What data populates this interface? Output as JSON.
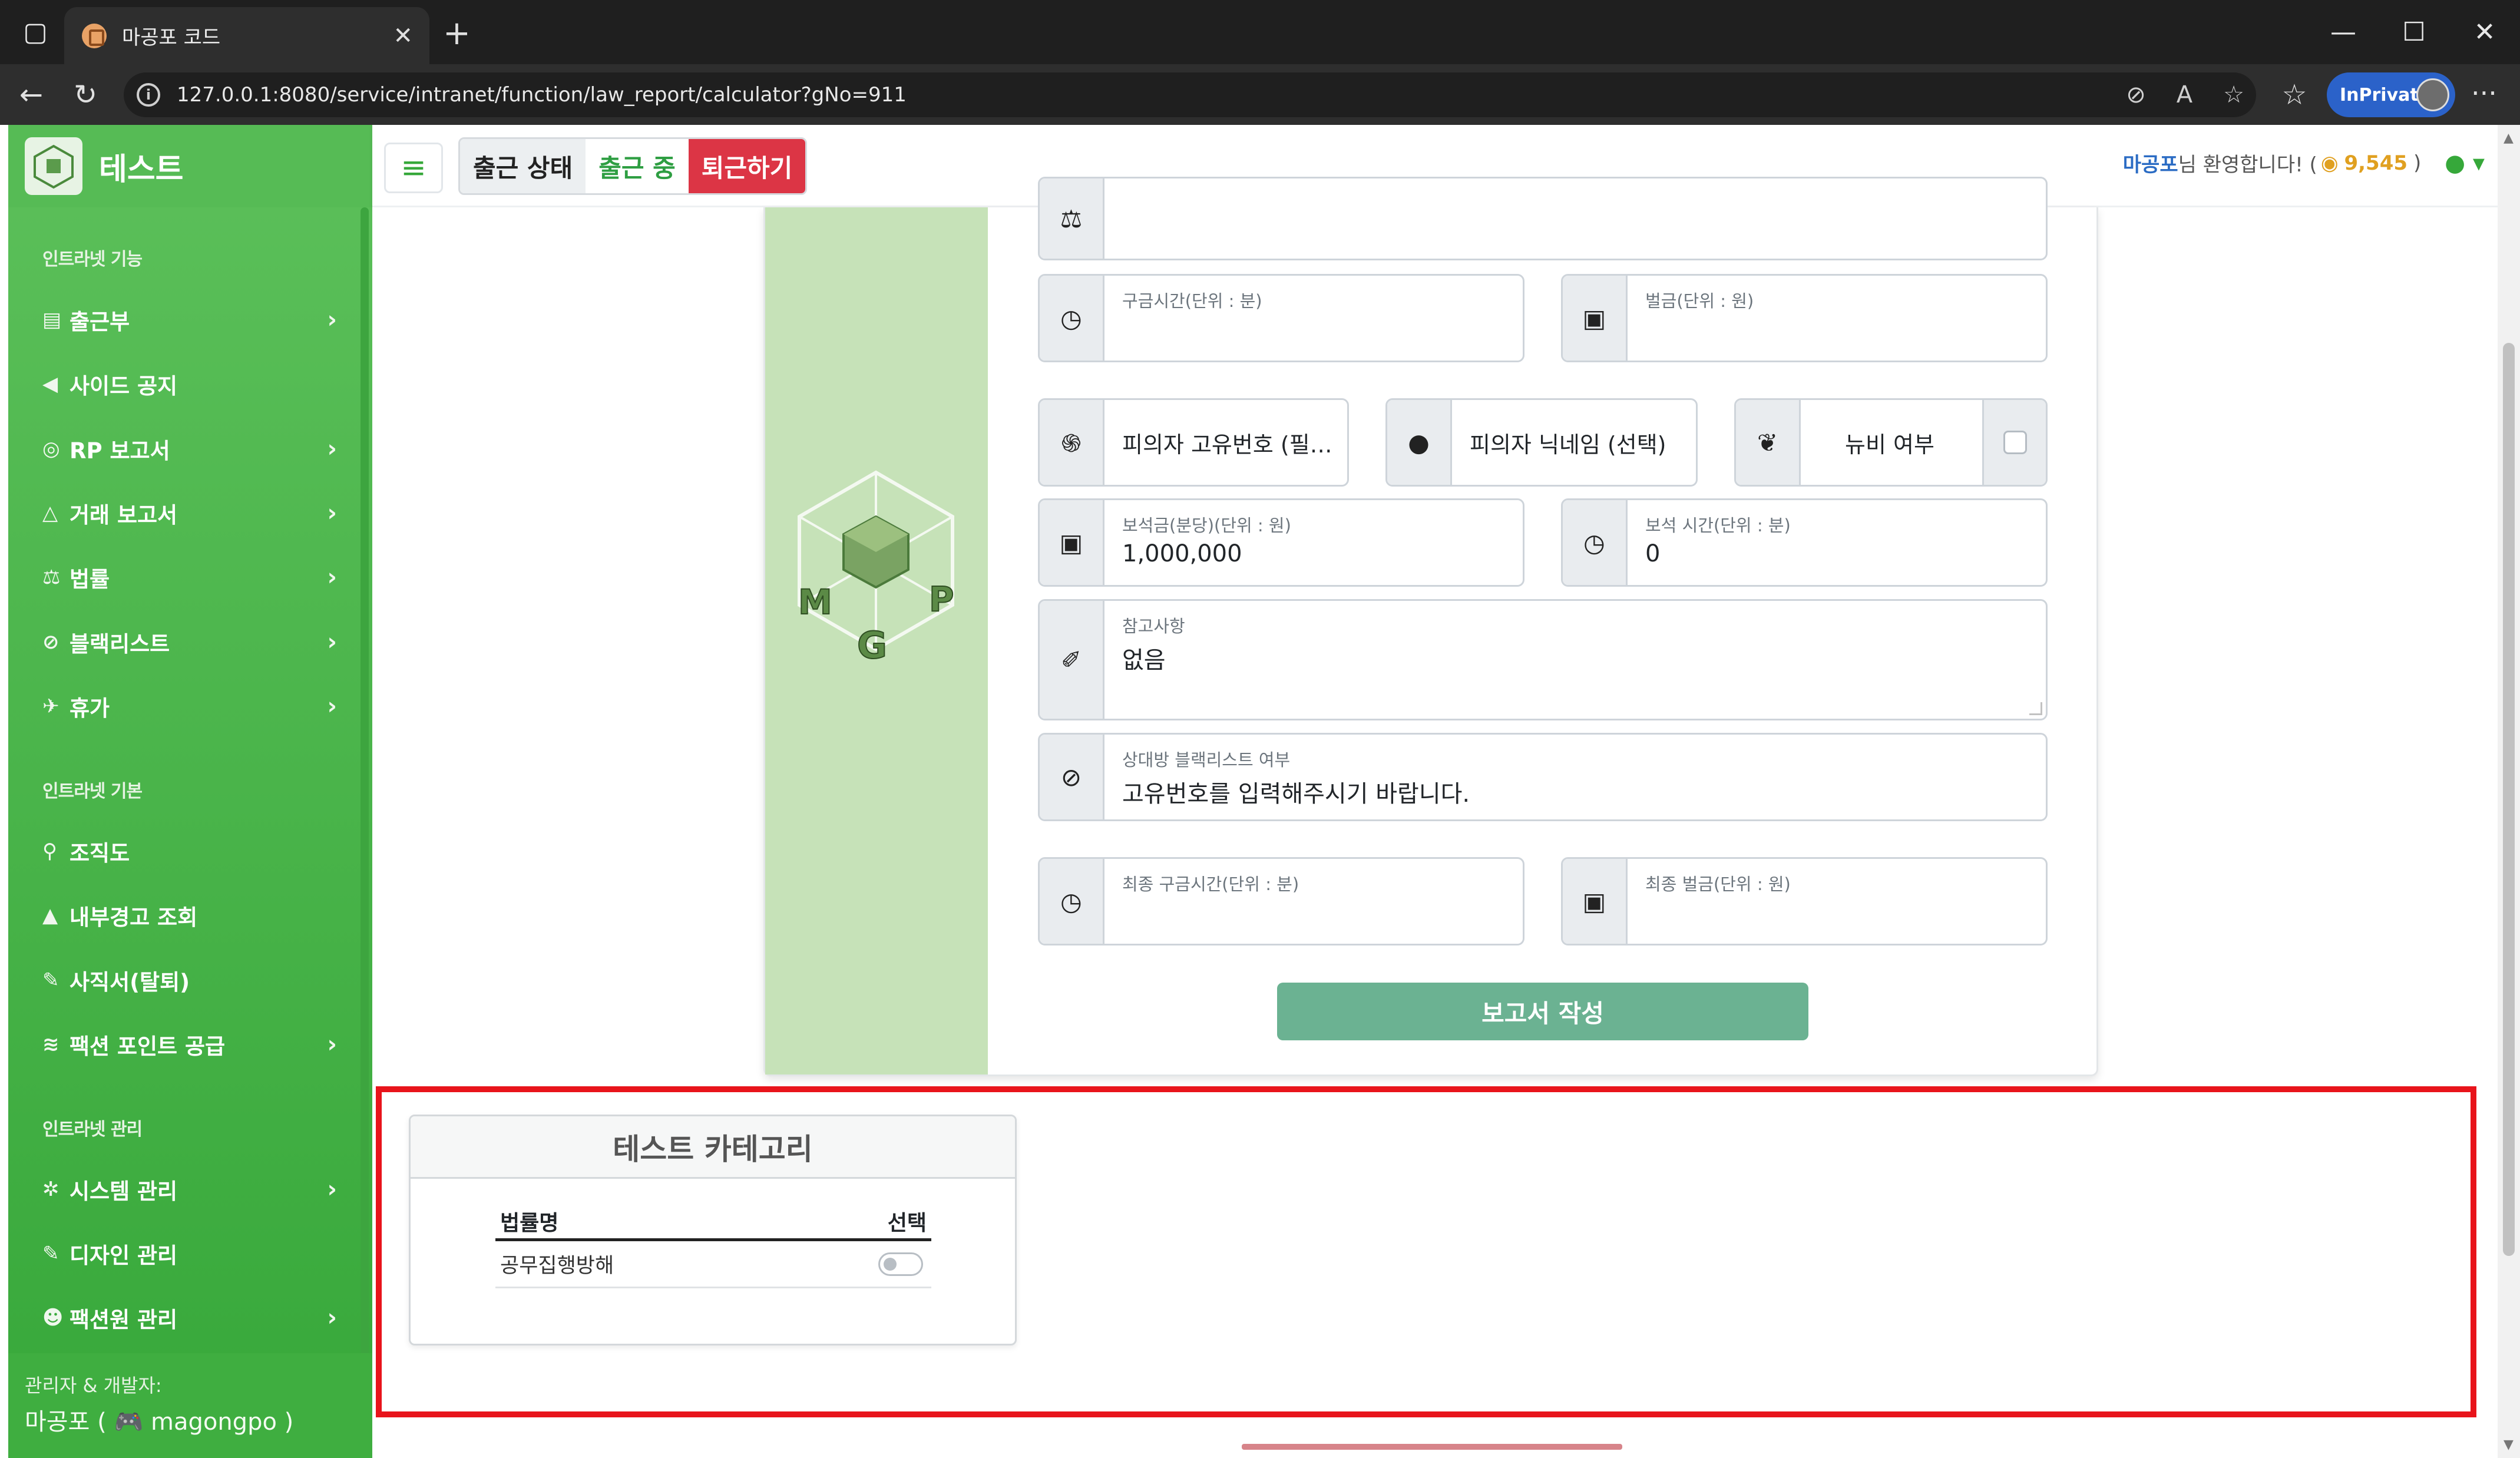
{
  "browser": {
    "tab_title": "마공포 코드",
    "url": "127.0.0.1:8080/service/intranet/function/law_report/calculator?gNo=911",
    "inprivate_label": "InPrivate"
  },
  "sidebar": {
    "brand": "테스트",
    "sections": [
      {
        "heading": "인트라넷 기능"
      },
      {
        "heading": "인트라넷 기본"
      },
      {
        "heading": "인트라넷 관리"
      }
    ],
    "items": [
      {
        "label": "출근부",
        "icon": "book-icon",
        "chevron": true
      },
      {
        "label": "사이드 공지",
        "icon": "megaphone-icon",
        "chevron": false
      },
      {
        "label": "RP 보고서",
        "icon": "gamepad-icon",
        "chevron": true
      },
      {
        "label": "거래 보고서",
        "icon": "flask-icon",
        "chevron": true
      },
      {
        "label": "법률",
        "icon": "scale-icon",
        "chevron": true
      },
      {
        "label": "블랙리스트",
        "icon": "ban-icon",
        "chevron": true
      },
      {
        "label": "휴가",
        "icon": "plane-icon",
        "chevron": true
      },
      {
        "label": "조직도",
        "icon": "sitemap-icon",
        "chevron": false
      },
      {
        "label": "내부경고 조회",
        "icon": "warning-icon",
        "chevron": false
      },
      {
        "label": "사직서(탈퇴)",
        "icon": "pen-icon",
        "chevron": false
      },
      {
        "label": "팩션 포인트 공급",
        "icon": "coins-icon",
        "chevron": true
      },
      {
        "label": "시스템 관리",
        "icon": "gear-icon",
        "chevron": true
      },
      {
        "label": "디자인 관리",
        "icon": "brush-icon",
        "chevron": false
      },
      {
        "label": "팩션원 관리",
        "icon": "users-gear-icon",
        "chevron": true
      }
    ],
    "footer": {
      "line1": "관리자 & 개발자:",
      "line2_prefix": "마공포 (",
      "line2_name": "magongpo",
      "line2_suffix": ")"
    }
  },
  "topnav": {
    "status_label": "출근 상태",
    "status_value": "출근 중",
    "leave_button": "퇴근하기",
    "welcome_name": "마공포",
    "welcome_text": "님 환영합니다! (",
    "points": "9,545",
    "welcome_close": ")"
  },
  "form": {
    "arrest_time": {
      "label": "구금시간(단위 : 분)",
      "value": ""
    },
    "fine": {
      "label": "벌금(단위 : 원)",
      "value": ""
    },
    "suspect_id": {
      "placeholder": "피의자 고유번호 (필…"
    },
    "suspect_nick": {
      "placeholder": "피의자 닉네임 (선택)"
    },
    "newbie": {
      "label": "뉴비 여부",
      "checked": false
    },
    "bail": {
      "label": "보석금(분당)(단위 : 원)",
      "value": "1,000,000"
    },
    "bail_time": {
      "label": "보석 시간(단위 : 분)",
      "value": "0"
    },
    "notes": {
      "label": "참고사항",
      "value": "없음"
    },
    "blacklist": {
      "label": "상대방 블랙리스트 여부",
      "value": "고유번호를 입력해주시기 바랍니다."
    },
    "final_time": {
      "label": "최종 구금시간(단위 : 분)",
      "value": ""
    },
    "final_fine": {
      "label": "최종 벌금(단위 : 원)",
      "value": ""
    },
    "submit_label": "보고서 작성"
  },
  "category": {
    "title": "테스트 카테고리",
    "headers": [
      "법률명",
      "선택"
    ],
    "rows": [
      {
        "name": "공무집행방해",
        "selected": false
      }
    ]
  },
  "colors": {
    "sidebar_green": "#37a83a",
    "danger_red": "#dc3545",
    "submit_green": "#6bb292",
    "highlight_red": "#e8141b"
  }
}
